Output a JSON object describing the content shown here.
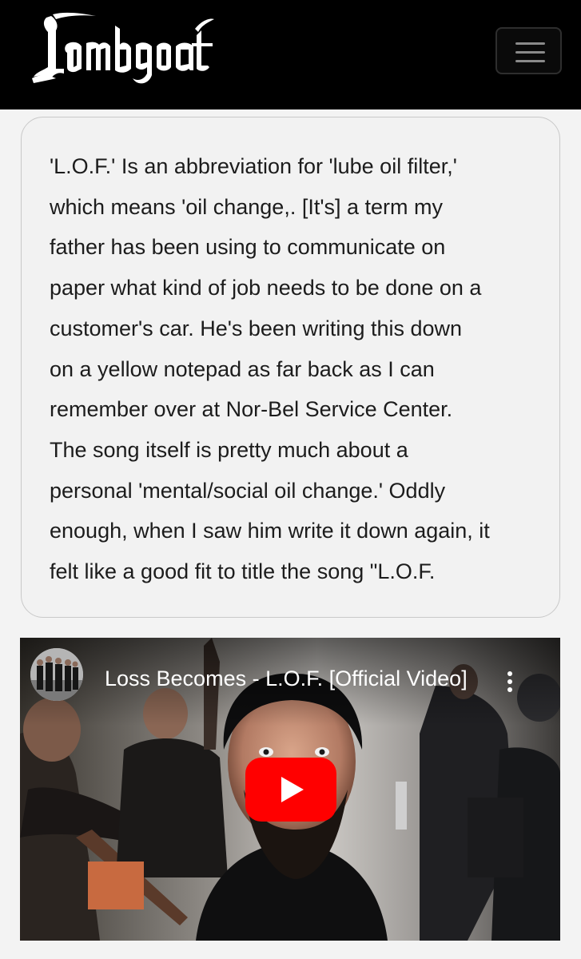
{
  "header": {
    "logo_text": "Lambgoat",
    "menu_icon": "hamburger-menu-icon",
    "colors": {
      "background": "#000000",
      "logo": "#ffffff"
    }
  },
  "quote": {
    "lines": [
      "'L.O.F.' Is an abbreviation for 'lube oil filter,'",
      "which means 'oil change,. [It's] a term my",
      "father has been using to communicate on",
      "paper what kind of job needs to be done on a",
      "customer's car. He's been writing this down",
      "on a yellow notepad as far back as I can",
      "remember over at Nor-Bel Service Center.",
      "The song itself is pretty much about a",
      "personal 'mental/social oil change.' Oddly",
      "enough, when I saw him write it down again, it",
      "felt like a good fit to title the song \"L.O.F."
    ]
  },
  "video": {
    "title": "Loss Becomes - L.O.F. [Official Video]",
    "more_icon": "vertical-ellipsis-icon",
    "play_icon": "youtube-play-icon",
    "colors": {
      "play_button": "#ff0000"
    }
  }
}
